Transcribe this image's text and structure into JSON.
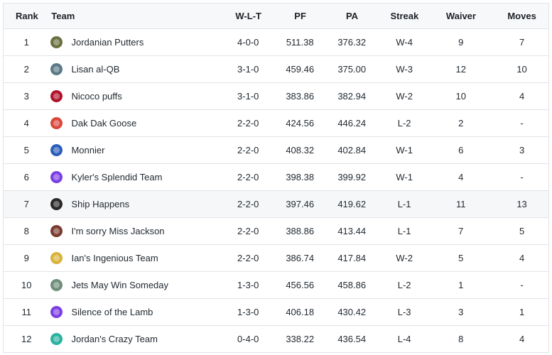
{
  "columns": {
    "rank": "Rank",
    "team": "Team",
    "wlt": "W-L-T",
    "pf": "PF",
    "pa": "PA",
    "streak": "Streak",
    "waiver": "Waiver",
    "moves": "Moves"
  },
  "rows": [
    {
      "rank": "1",
      "team": "Jordanian Putters",
      "avatar": "team-avatar-icon",
      "avatar_color": "#6b7040",
      "wlt": "4-0-0",
      "pf": "511.38",
      "pa": "376.32",
      "streak": "W-4",
      "waiver": "9",
      "moves": "7"
    },
    {
      "rank": "2",
      "team": "Lisan al-QB",
      "avatar": "team-avatar-icon",
      "avatar_color": "#5a7a86",
      "wlt": "3-1-0",
      "pf": "459.46",
      "pa": "375.00",
      "streak": "W-3",
      "waiver": "12",
      "moves": "10"
    },
    {
      "rank": "3",
      "team": "Nicoco puffs",
      "avatar": "team-avatar-icon",
      "avatar_color": "#b0122b",
      "wlt": "3-1-0",
      "pf": "383.86",
      "pa": "382.94",
      "streak": "W-2",
      "waiver": "10",
      "moves": "4"
    },
    {
      "rank": "4",
      "team": "Dak Dak Goose",
      "avatar": "team-avatar-icon",
      "avatar_color": "#d9483b",
      "wlt": "2-2-0",
      "pf": "424.56",
      "pa": "446.24",
      "streak": "L-2",
      "waiver": "2",
      "moves": "-"
    },
    {
      "rank": "5",
      "team": "Monnier",
      "avatar": "team-avatar-icon",
      "avatar_color": "#2c5fb8",
      "wlt": "2-2-0",
      "pf": "408.32",
      "pa": "402.84",
      "streak": "W-1",
      "waiver": "6",
      "moves": "3"
    },
    {
      "rank": "6",
      "team": "Kyler's Splendid Team",
      "avatar": "team-avatar-icon",
      "avatar_color": "#7b3fe4",
      "wlt": "2-2-0",
      "pf": "398.38",
      "pa": "399.92",
      "streak": "W-1",
      "waiver": "4",
      "moves": "-"
    },
    {
      "rank": "7",
      "team": "Ship Happens",
      "avatar": "team-avatar-icon",
      "avatar_color": "#2a2a2a",
      "wlt": "2-2-0",
      "pf": "397.46",
      "pa": "419.62",
      "streak": "L-1",
      "waiver": "11",
      "moves": "13"
    },
    {
      "rank": "8",
      "team": "I'm sorry Miss Jackson",
      "avatar": "team-avatar-icon",
      "avatar_color": "#7a3b2e",
      "wlt": "2-2-0",
      "pf": "388.86",
      "pa": "413.44",
      "streak": "L-1",
      "waiver": "7",
      "moves": "5"
    },
    {
      "rank": "9",
      "team": "Ian's Ingenious Team",
      "avatar": "team-avatar-icon",
      "avatar_color": "#d9b23a",
      "wlt": "2-2-0",
      "pf": "386.74",
      "pa": "417.84",
      "streak": "W-2",
      "waiver": "5",
      "moves": "4"
    },
    {
      "rank": "10",
      "team": "Jets May Win Someday",
      "avatar": "team-avatar-icon",
      "avatar_color": "#6f8f7a",
      "wlt": "1-3-0",
      "pf": "456.56",
      "pa": "458.86",
      "streak": "L-2",
      "waiver": "1",
      "moves": "-"
    },
    {
      "rank": "11",
      "team": "Silence of the Lamb",
      "avatar": "team-avatar-icon",
      "avatar_color": "#7b3fe4",
      "wlt": "1-3-0",
      "pf": "406.18",
      "pa": "430.42",
      "streak": "L-3",
      "waiver": "3",
      "moves": "1"
    },
    {
      "rank": "12",
      "team": "Jordan's Crazy Team",
      "avatar": "team-avatar-icon",
      "avatar_color": "#2bb3a0",
      "wlt": "0-4-0",
      "pf": "338.22",
      "pa": "436.54",
      "streak": "L-4",
      "waiver": "8",
      "moves": "4"
    }
  ],
  "hovered_row": "7"
}
